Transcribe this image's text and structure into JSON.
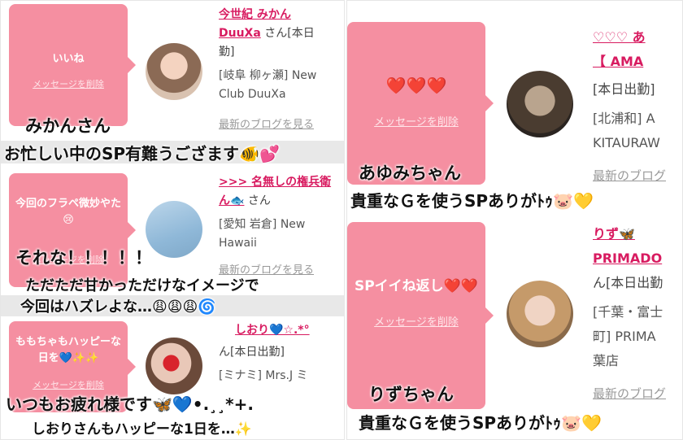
{
  "left": {
    "rows": [
      {
        "card_message": "いいね",
        "delete_label": "メッセージを削除",
        "name_line1": "今世紀 みかん",
        "name_line2": "DuuXa",
        "san": "さん[本日",
        "status_tail": "勤]",
        "shop_line1": "[岐阜 柳ヶ瀬] New",
        "shop_line2": "Club DuuXa",
        "blog_link": "最新のブログを見る",
        "caption_name": "みかんさん",
        "caption_main": "お忙しい中のSP有難うござます🐠💕"
      },
      {
        "card_message": "今回のフラペ微妙やた😢",
        "delete_label": "メッセージを削除",
        "name_line1": ">>> 名無しの権兵衛",
        "name_line2": "ん🐟",
        "san": "さん",
        "shop_line1": "[愛知 岩倉] New",
        "shop_line2": "Hawaii",
        "blog_link": "最新のブログを見る",
        "caption_line1": "それな！！！！！",
        "caption_line2": "ただただ甘かっただけなイメージで",
        "caption_line3": "今回はハズレよな…😩😩😩🌀"
      },
      {
        "card_message": "ももちゃもハッピーな日を💙✨✨",
        "delete_label": "メッセージを削除",
        "name_line1": "しおり💙☆.*°",
        "status": "ん[本日出勤]",
        "shop_line1": "[ミナミ] Mrs.J ミ",
        "caption_line1": "いつもお疲れ様です🦋💙•.¸¸*+.",
        "caption_line2": "しおりさんもハッピーな1日を…✨"
      }
    ]
  },
  "right": {
    "rows": [
      {
        "card_message": "❤️❤️❤️",
        "delete_label": "メッセージを削除",
        "name_line1": "♡♡♡ あ",
        "name_line2": "【 AMA",
        "status": "[本日出勤]",
        "shop_line1": "[北浦和] A",
        "shop_line2": "KITAURAW",
        "blog_link": "最新のブログ",
        "caption_name": "あゆみちゃん",
        "caption_main": "貴重なＧを使うSPありがﾄｩ🐷💛"
      },
      {
        "card_message": "SPイイね返し❤️❤️",
        "delete_label": "メッセージを削除",
        "name_line1": "りず🦋",
        "name_line2": "PRIMADO",
        "status": "ん[本日出勤",
        "shop_line1": "[千葉・富士",
        "shop_line2": "町] PRIMA",
        "shop_line3": "葉店",
        "blog_link": "最新のブログ",
        "caption_name": "りずちゃん",
        "caption_main": "貴重なＧを使うSPありがﾄｩ🐷💛"
      }
    ]
  },
  "colors": {
    "card": "#f58fa1",
    "link": "#d81b60"
  },
  "icons": [
    "heart-icon",
    "fish-icon",
    "butterfly-icon",
    "pig-icon",
    "sparkle-icon"
  ]
}
